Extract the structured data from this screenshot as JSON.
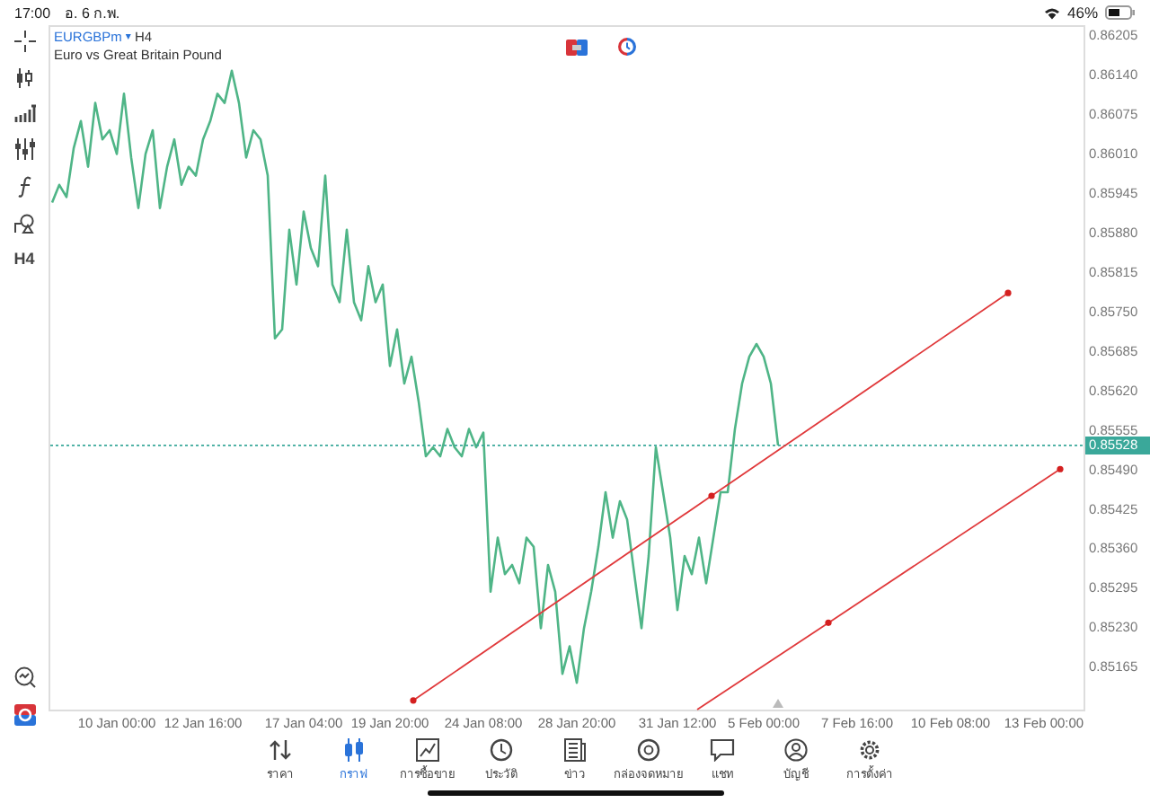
{
  "status_bar": {
    "time": "17:00",
    "date": "อ. 6 ก.พ.",
    "battery": "46%"
  },
  "toolbar": {
    "timeframe_button": "H4"
  },
  "chart": {
    "symbol": "EURGBPm",
    "dropdown": "▾",
    "timeframe": "H4",
    "description": "Euro vs Great Britain Pound",
    "chart_data": {
      "type": "line",
      "ylim": [
        0.85093,
        0.8622
      ],
      "categories": [
        null,
        null,
        null,
        null,
        null,
        null,
        null,
        null,
        null,
        "10 Jan 00:00",
        null,
        null,
        null,
        null,
        null,
        null,
        null,
        null,
        null,
        null,
        null,
        "12 Jan 16:00",
        null,
        null,
        null,
        null,
        null,
        null,
        null,
        null,
        null,
        null,
        null,
        null,
        null,
        "17 Jan 04:00",
        null,
        null,
        null,
        null,
        null,
        null,
        null,
        null,
        null,
        null,
        null,
        "19 Jan 20:00",
        null,
        null,
        null,
        null,
        null,
        null,
        null,
        null,
        null,
        null,
        null,
        null,
        "24 Jan 08:00",
        null,
        null,
        null,
        null,
        null,
        null,
        null,
        null,
        null,
        null,
        null,
        null,
        "28 Jan 20:00",
        null,
        null,
        null,
        null,
        null,
        null,
        null,
        null,
        null,
        null,
        null,
        null,
        null,
        "31 Jan 12:00",
        null,
        null,
        null,
        null,
        null,
        null,
        null,
        null,
        null,
        null,
        null,
        "5 Feb 00:00",
        null,
        null,
        null,
        null,
        null,
        null,
        null,
        null,
        null,
        null,
        null,
        null,
        "7 Feb 16:00",
        null,
        null,
        null,
        null,
        null,
        null,
        null,
        null,
        null,
        null,
        null,
        null,
        "10 Feb 08:00",
        null,
        null,
        null,
        null,
        null,
        null,
        null,
        null,
        null,
        null,
        null,
        null,
        "13 Feb 00:00",
        null,
        null,
        null,
        null,
        null
      ],
      "series": [
        {
          "color": "#4fb587",
          "values": [
            0.85928,
            0.85957,
            0.85937,
            0.86017,
            0.86062,
            0.85987,
            0.86092,
            0.86032,
            0.86047,
            0.86008,
            0.86107,
            0.86002,
            0.85919,
            0.86008,
            0.86047,
            0.85919,
            0.85987,
            0.86032,
            0.85957,
            0.85987,
            0.85972,
            0.86032,
            0.86062,
            0.86107,
            0.86092,
            0.86145,
            0.86092,
            0.86002,
            0.86047,
            0.86032,
            0.85972,
            0.85704,
            0.85719,
            0.85883,
            0.85793,
            0.85913,
            0.85853,
            0.85823,
            0.85972,
            0.85793,
            0.85764,
            0.85883,
            0.85764,
            0.85734,
            0.85823,
            0.85764,
            0.85793,
            0.85659,
            0.85719,
            0.8563,
            0.85674,
            0.856,
            0.8551,
            0.85525,
            0.8551,
            0.85555,
            0.85525,
            0.8551,
            0.85555,
            0.85525,
            0.85549,
            0.85287,
            0.85376,
            0.85316,
            0.85331,
            0.85301,
            0.85376,
            0.85361,
            0.85227,
            0.85331,
            0.85287,
            0.85152,
            0.85197,
            0.85137,
            0.85227,
            0.85287,
            0.85361,
            0.85451,
            0.85376,
            0.85436,
            0.85406,
            0.85316,
            0.85227,
            0.85346,
            0.85525,
            0.85451,
            0.85376,
            0.85257,
            0.85346,
            0.85316,
            0.85376,
            0.85301,
            0.85376,
            0.85451,
            0.85451,
            0.85555,
            0.8563,
            0.85674,
            0.85695,
            0.85674,
            0.8563,
            0.85528,
            null,
            null,
            null,
            null,
            null,
            null,
            null,
            null,
            null,
            null,
            null,
            null,
            null,
            null,
            null,
            null,
            null,
            null,
            null,
            null,
            null,
            null,
            null,
            null,
            null,
            null,
            null,
            null,
            null,
            null,
            null,
            null,
            null,
            null,
            null,
            null,
            null,
            null,
            null,
            null,
            null,
            null
          ]
        }
      ],
      "yticks": [
        {
          "value": 0.86205,
          "label": "0.86205"
        },
        {
          "value": 0.8614,
          "label": "0.86140"
        },
        {
          "value": 0.86075,
          "label": "0.86075"
        },
        {
          "value": 0.8601,
          "label": "0.86010"
        },
        {
          "value": 0.85945,
          "label": "0.85945"
        },
        {
          "value": 0.8588,
          "label": "0.85880"
        },
        {
          "value": 0.85815,
          "label": "0.85815"
        },
        {
          "value": 0.8575,
          "label": "0.85750"
        },
        {
          "value": 0.85685,
          "label": "0.85685"
        },
        {
          "value": 0.8562,
          "label": "0.85620"
        },
        {
          "value": 0.85555,
          "label": "0.85555"
        },
        {
          "value": 0.8549,
          "label": "0.85490"
        },
        {
          "value": 0.85425,
          "label": "0.85425"
        },
        {
          "value": 0.8536,
          "label": "0.85360"
        },
        {
          "value": 0.85295,
          "label": "0.85295"
        },
        {
          "value": 0.8523,
          "label": "0.85230"
        },
        {
          "value": 0.85165,
          "label": "0.85165"
        }
      ],
      "ref_lines": [
        {
          "axis": "y",
          "value": 0.85528,
          "label": "0.85528"
        }
      ]
    }
  },
  "nav": [
    {
      "kind": "quotes",
      "label": "ราคา",
      "selected": false
    },
    {
      "kind": "chart",
      "label": "กราฟ",
      "selected": true
    },
    {
      "kind": "trade",
      "label": "การซื้อขาย",
      "selected": false
    },
    {
      "kind": "history",
      "label": "ประวัติ",
      "selected": false
    },
    {
      "kind": "news",
      "label": "ข่าว",
      "selected": false
    },
    {
      "kind": "mail",
      "label": "กล่องจดหมาย",
      "selected": false
    },
    {
      "kind": "chat",
      "label": "แชท",
      "selected": false
    },
    {
      "kind": "account",
      "label": "บัญชี",
      "selected": false
    },
    {
      "kind": "settings",
      "label": "การตั้งค่า",
      "selected": false
    }
  ]
}
